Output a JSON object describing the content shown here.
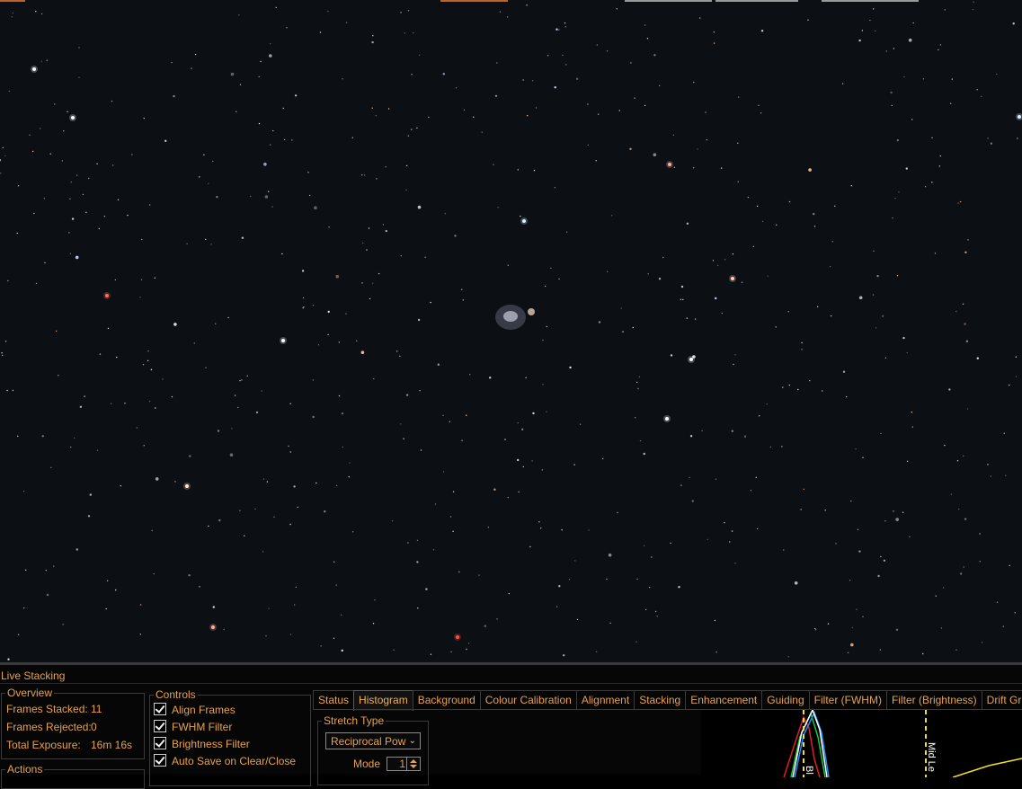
{
  "panel": {
    "title": "Live Stacking"
  },
  "overview": {
    "legend": "Overview",
    "frames_stacked_label": "Frames Stacked:",
    "frames_stacked_value": "11",
    "frames_rejected_label": "Frames Rejected:",
    "frames_rejected_value": "0",
    "total_exposure_label": "Total Exposure:",
    "total_exposure_value": "16m 16s"
  },
  "actions": {
    "legend": "Actions"
  },
  "controls": {
    "legend": "Controls",
    "items": [
      {
        "label": "Align Frames",
        "checked": true
      },
      {
        "label": "FWHM Filter",
        "checked": true
      },
      {
        "label": "Brightness Filter",
        "checked": true
      },
      {
        "label": "Auto Save on Clear/Close",
        "checked": true
      }
    ]
  },
  "tabs": [
    "Status",
    "Histogram",
    "Background",
    "Colour Calibration",
    "Alignment",
    "Stacking",
    "Enhancement",
    "Guiding",
    "Filter (FWHM)",
    "Filter (Brightness)",
    "Drift Gr"
  ],
  "active_tab": "Histogram",
  "stretch": {
    "legend": "Stretch Type",
    "type_value": "Reciprocal Pow",
    "mode_label": "Mode",
    "mode_value": "1"
  },
  "histogram": {
    "black_label": "Bl",
    "mid_label": "Mid Le",
    "colors": {
      "red": "#e02020",
      "green": "#20c040",
      "blue": "#2090ff",
      "luminance": "#ffffff",
      "marker": "#f2e030"
    }
  },
  "image": {
    "background": "#0c0f14"
  }
}
